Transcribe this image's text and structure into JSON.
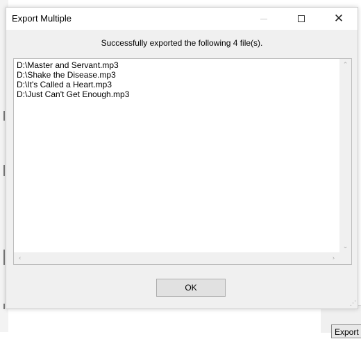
{
  "window": {
    "title": "Export Multiple",
    "close_symbol": "✕"
  },
  "message": "Successfully exported the following 4 file(s).",
  "files": [
    "D:\\Master and Servant.mp3",
    "D:\\Shake the Disease.mp3",
    "D:\\It's Called a Heart.mp3",
    "D:\\Just Can't Get Enough.mp3"
  ],
  "scrollbar_glyphs": {
    "up": "⌃",
    "down": "⌄",
    "left": "‹",
    "right": "›"
  },
  "buttons": {
    "ok_label": "OK"
  },
  "background": {
    "export_tab_label": "Export"
  },
  "icons": {
    "minimize": "minimize-icon",
    "maximize": "maximize-icon",
    "close": "close-icon",
    "resize_grip": "resize-grip-icon"
  }
}
